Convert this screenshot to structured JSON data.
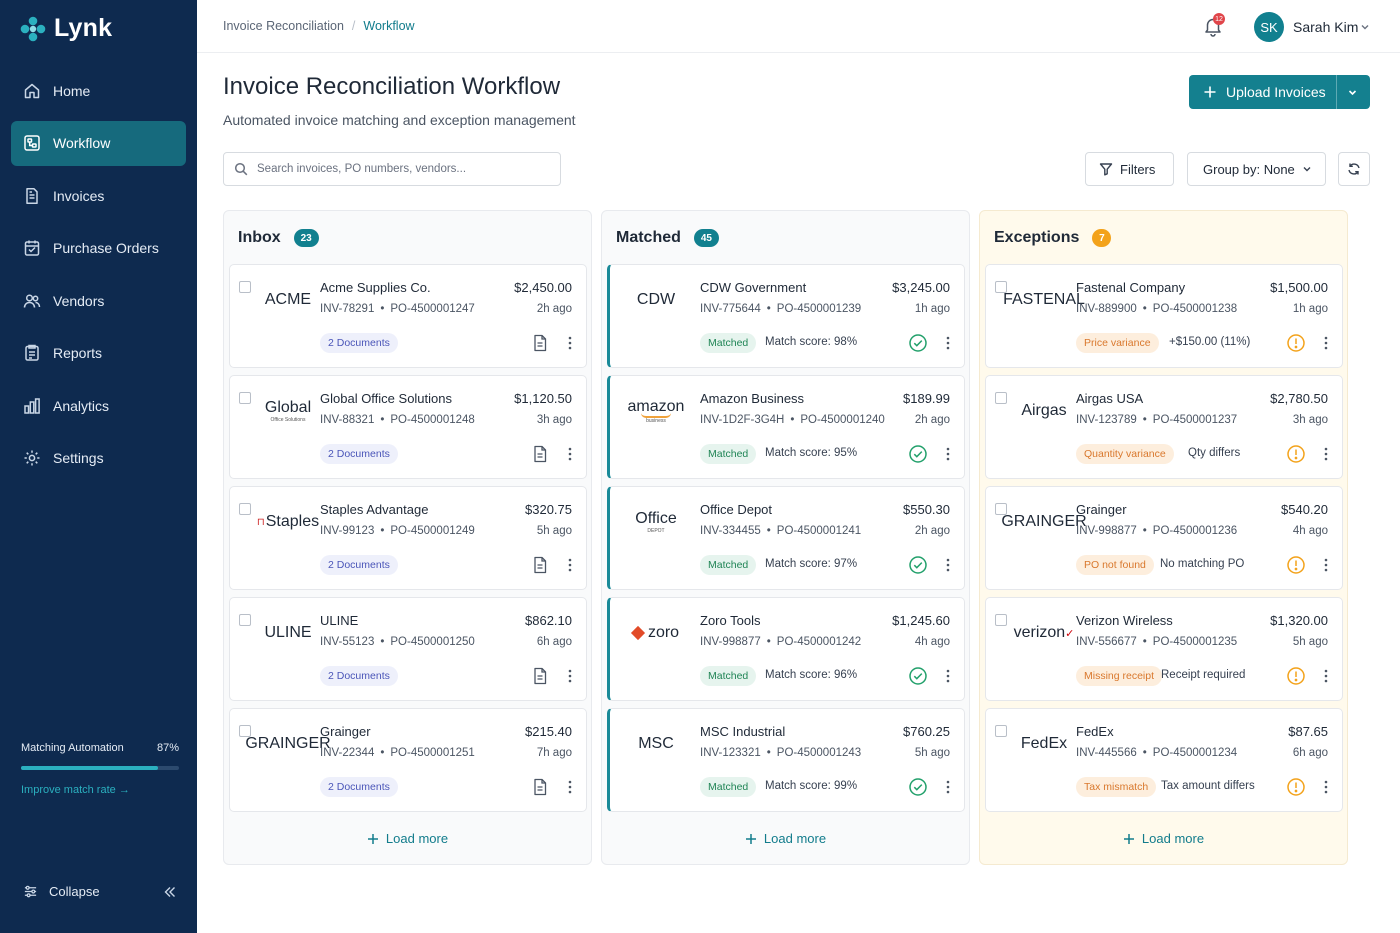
{
  "app": {
    "name": "Lynk"
  },
  "sidebar": {
    "items": [
      {
        "label": "Home",
        "icon": "home-icon",
        "active": false
      },
      {
        "label": "Workflow",
        "icon": "workflow-icon",
        "active": true
      },
      {
        "label": "Invoices",
        "icon": "invoice-icon",
        "active": false
      },
      {
        "label": "Purchase Orders",
        "icon": "purchase-order-icon",
        "active": false
      },
      {
        "label": "Vendors",
        "icon": "vendors-icon",
        "active": false
      },
      {
        "label": "Reports",
        "icon": "reports-icon",
        "active": false
      },
      {
        "label": "Analytics",
        "icon": "analytics-icon",
        "active": false
      },
      {
        "label": "Settings",
        "icon": "settings-icon",
        "active": false
      }
    ],
    "automation": {
      "label": "Matching Automation",
      "percent_label": "87%",
      "percent": 0.87,
      "link": "Improve match rate →"
    },
    "collapse_label": "Collapse"
  },
  "header": {
    "breadcrumb": {
      "parent": "Invoice Reconciliation",
      "separator": "/",
      "current": "Workflow"
    },
    "notification_count": "12",
    "user": {
      "initials": "SK",
      "name": "Sarah Kim"
    }
  },
  "page": {
    "title": "Invoice Reconciliation Workflow",
    "subtitle": "Automated invoice matching and exception management",
    "upload_label": "Upload Invoices",
    "search_placeholder": "Search invoices, PO numbers, vendors...",
    "filters_label": "Filters",
    "group_by_label": "Group by: None"
  },
  "colors": {
    "sidebar": "#0e2a4f",
    "accent": "#14808f",
    "warning": "#f3a21a",
    "success": "#208556"
  },
  "columns": {
    "inbox": {
      "title": "Inbox",
      "count": "23",
      "load_more": "Load more",
      "cards": [
        {
          "vendor": "Acme Supplies Co.",
          "logo": "ACME",
          "invoice": "INV-78291",
          "po": "PO-4500001247",
          "amount": "$2,450.00",
          "age": "2h ago",
          "docs": "2 Documents"
        },
        {
          "vendor": "Global Office Solutions",
          "logo": "Global",
          "logo_sub": "Office Solutions",
          "invoice": "INV-88321",
          "po": "PO-4500001248",
          "amount": "$1,120.50",
          "age": "3h ago",
          "docs": "2 Documents"
        },
        {
          "vendor": "Staples Advantage",
          "logo": "Staples",
          "invoice": "INV-99123",
          "po": "PO-4500001249",
          "amount": "$320.75",
          "age": "5h ago",
          "docs": "2 Documents"
        },
        {
          "vendor": "ULINE",
          "logo": "ULINE",
          "invoice": "INV-55123",
          "po": "PO-4500001250",
          "amount": "$862.10",
          "age": "6h ago",
          "docs": "2 Documents"
        },
        {
          "vendor": "Grainger",
          "logo": "GRAINGER",
          "invoice": "INV-22344",
          "po": "PO-4500001251",
          "amount": "$215.40",
          "age": "7h ago",
          "docs": "2 Documents"
        }
      ]
    },
    "matched": {
      "title": "Matched",
      "count": "45",
      "load_more": "Load more",
      "cards": [
        {
          "vendor": "CDW Government",
          "logo": "CDW",
          "invoice": "INV-775644",
          "po": "PO-4500001239",
          "amount": "$3,245.00",
          "age": "1h ago",
          "status": "Matched",
          "score": "Match score: 98%"
        },
        {
          "vendor": "Amazon Business",
          "logo": "amazon",
          "logo_sub": "business",
          "invoice": "INV-1D2F-3G4H",
          "po": "PO-4500001240",
          "amount": "$189.99",
          "age": "2h ago",
          "status": "Matched",
          "score": "Match score: 95%"
        },
        {
          "vendor": "Office Depot",
          "logo": "Office",
          "logo_sub": "DEPOT",
          "invoice": "INV-334455",
          "po": "PO-4500001241",
          "amount": "$550.30",
          "age": "2h ago",
          "status": "Matched",
          "score": "Match score: 97%"
        },
        {
          "vendor": "Zoro Tools",
          "logo": "zoro",
          "invoice": "INV-998877",
          "po": "PO-4500001242",
          "amount": "$1,245.60",
          "age": "4h ago",
          "status": "Matched",
          "score": "Match score: 96%"
        },
        {
          "vendor": "MSC Industrial",
          "logo": "MSC",
          "invoice": "INV-123321",
          "po": "PO-4500001243",
          "amount": "$760.25",
          "age": "5h ago",
          "status": "Matched",
          "score": "Match score: 99%"
        }
      ]
    },
    "exceptions": {
      "title": "Exceptions",
      "count": "7",
      "load_more": "Load more",
      "cards": [
        {
          "vendor": "Fastenal Company",
          "logo": "FASTENAL",
          "invoice": "INV-889900",
          "po": "PO-4500001238",
          "amount": "$1,500.00",
          "age": "1h ago",
          "issue": "Price variance",
          "detail": "+$150.00 (11%)"
        },
        {
          "vendor": "Airgas USA",
          "logo": "Airgas",
          "invoice": "INV-123789",
          "po": "PO-4500001237",
          "amount": "$2,780.50",
          "age": "3h ago",
          "issue": "Quantity variance",
          "detail": "Qty differs"
        },
        {
          "vendor": "Grainger",
          "logo": "GRAINGER",
          "invoice": "INV-998877",
          "po": "PO-4500001236",
          "amount": "$540.20",
          "age": "4h ago",
          "issue": "PO not found",
          "detail": "No matching PO"
        },
        {
          "vendor": "Verizon Wireless",
          "logo": "verizon",
          "invoice": "INV-556677",
          "po": "PO-4500001235",
          "amount": "$1,320.00",
          "age": "5h ago",
          "issue": "Missing receipt",
          "detail": "Receipt required"
        },
        {
          "vendor": "FedEx",
          "logo": "FedEx",
          "invoice": "INV-445566",
          "po": "PO-4500001234",
          "amount": "$87.65",
          "age": "6h ago",
          "issue": "Tax mismatch",
          "detail": "Tax amount differs"
        }
      ]
    }
  }
}
